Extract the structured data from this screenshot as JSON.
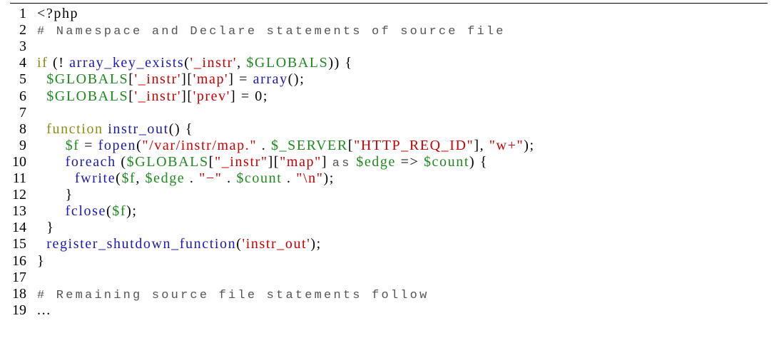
{
  "colors": {
    "keyword": "#8c8c14",
    "function": "#1b1bb3",
    "string": "#cc0000",
    "variable": "#1f8a1f",
    "comment": "#555555",
    "plain": "#000000"
  },
  "lines": [
    {
      "n": "1",
      "tokens": [
        {
          "t": "<?php",
          "c": "plain"
        }
      ]
    },
    {
      "n": "2",
      "tokens": [
        {
          "t": "# Namespace and Declare statements of source file",
          "c": "comment"
        }
      ]
    },
    {
      "n": "3",
      "tokens": []
    },
    {
      "n": "4",
      "tokens": [
        {
          "t": "if",
          "c": "keyword"
        },
        {
          "t": " (! ",
          "c": "plain"
        },
        {
          "t": "array_key_exists",
          "c": "function"
        },
        {
          "t": "(",
          "c": "plain"
        },
        {
          "t": "'_instr'",
          "c": "string"
        },
        {
          "t": ", ",
          "c": "plain"
        },
        {
          "t": "$GLOBALS",
          "c": "variable"
        },
        {
          "t": ")) {",
          "c": "plain"
        }
      ]
    },
    {
      "n": "5",
      "tokens": [
        {
          "t": "  ",
          "c": "plain"
        },
        {
          "t": "$GLOBALS",
          "c": "variable"
        },
        {
          "t": "[",
          "c": "plain"
        },
        {
          "t": "'_instr'",
          "c": "string"
        },
        {
          "t": "][",
          "c": "plain"
        },
        {
          "t": "'map'",
          "c": "string"
        },
        {
          "t": "] = ",
          "c": "plain"
        },
        {
          "t": "array",
          "c": "function"
        },
        {
          "t": "();",
          "c": "plain"
        }
      ]
    },
    {
      "n": "6",
      "tokens": [
        {
          "t": "  ",
          "c": "plain"
        },
        {
          "t": "$GLOBALS",
          "c": "variable"
        },
        {
          "t": "[",
          "c": "plain"
        },
        {
          "t": "'_instr'",
          "c": "string"
        },
        {
          "t": "][",
          "c": "plain"
        },
        {
          "t": "'prev'",
          "c": "string"
        },
        {
          "t": "] = 0;",
          "c": "plain"
        }
      ]
    },
    {
      "n": "7",
      "tokens": []
    },
    {
      "n": "8",
      "tokens": [
        {
          "t": "  ",
          "c": "plain"
        },
        {
          "t": "function",
          "c": "keyword"
        },
        {
          "t": " ",
          "c": "plain"
        },
        {
          "t": "instr_out",
          "c": "function"
        },
        {
          "t": "() {",
          "c": "plain"
        }
      ]
    },
    {
      "n": "9",
      "tokens": [
        {
          "t": "      ",
          "c": "plain"
        },
        {
          "t": "$f",
          "c": "variable"
        },
        {
          "t": " = ",
          "c": "plain"
        },
        {
          "t": "fopen",
          "c": "function"
        },
        {
          "t": "(",
          "c": "plain"
        },
        {
          "t": "\"/var/instr/map.\"",
          "c": "string"
        },
        {
          "t": " . ",
          "c": "plain"
        },
        {
          "t": "$_SERVER",
          "c": "variable"
        },
        {
          "t": "[",
          "c": "plain"
        },
        {
          "t": "\"HTTP_REQ_ID\"",
          "c": "string"
        },
        {
          "t": "], ",
          "c": "plain"
        },
        {
          "t": "\"w+\"",
          "c": "string"
        },
        {
          "t": ");",
          "c": "plain"
        }
      ]
    },
    {
      "n": "10",
      "tokens": [
        {
          "t": "      ",
          "c": "plain"
        },
        {
          "t": "foreach",
          "c": "function"
        },
        {
          "t": " (",
          "c": "plain"
        },
        {
          "t": "$GLOBALS",
          "c": "variable"
        },
        {
          "t": "[",
          "c": "plain"
        },
        {
          "t": "\"_instr\"",
          "c": "string"
        },
        {
          "t": "][",
          "c": "plain"
        },
        {
          "t": "\"map\"",
          "c": "string"
        },
        {
          "t": "] ",
          "c": "plain"
        },
        {
          "t": "as",
          "c": "comment"
        },
        {
          "t": " ",
          "c": "plain"
        },
        {
          "t": "$edge",
          "c": "variable"
        },
        {
          "t": " => ",
          "c": "plain"
        },
        {
          "t": "$count",
          "c": "variable"
        },
        {
          "t": ") {",
          "c": "plain"
        }
      ]
    },
    {
      "n": "11",
      "tokens": [
        {
          "t": "        ",
          "c": "plain"
        },
        {
          "t": "fwrite",
          "c": "function"
        },
        {
          "t": "(",
          "c": "plain"
        },
        {
          "t": "$f",
          "c": "variable"
        },
        {
          "t": ", ",
          "c": "plain"
        },
        {
          "t": "$edge",
          "c": "variable"
        },
        {
          "t": " . ",
          "c": "plain"
        },
        {
          "t": "\"−\"",
          "c": "string"
        },
        {
          "t": " . ",
          "c": "plain"
        },
        {
          "t": "$count",
          "c": "variable"
        },
        {
          "t": " . ",
          "c": "plain"
        },
        {
          "t": "\"\\n\"",
          "c": "string"
        },
        {
          "t": ");",
          "c": "plain"
        }
      ]
    },
    {
      "n": "12",
      "tokens": [
        {
          "t": "      }",
          "c": "plain"
        }
      ]
    },
    {
      "n": "13",
      "tokens": [
        {
          "t": "      ",
          "c": "plain"
        },
        {
          "t": "fclose",
          "c": "function"
        },
        {
          "t": "(",
          "c": "plain"
        },
        {
          "t": "$f",
          "c": "variable"
        },
        {
          "t": ");",
          "c": "plain"
        }
      ]
    },
    {
      "n": "14",
      "tokens": [
        {
          "t": "  }",
          "c": "plain"
        }
      ]
    },
    {
      "n": "15",
      "tokens": [
        {
          "t": "  ",
          "c": "plain"
        },
        {
          "t": "register_shutdown_function",
          "c": "function"
        },
        {
          "t": "(",
          "c": "plain"
        },
        {
          "t": "'instr_out'",
          "c": "string"
        },
        {
          "t": ");",
          "c": "plain"
        }
      ]
    },
    {
      "n": "16",
      "tokens": [
        {
          "t": "}",
          "c": "plain"
        }
      ]
    },
    {
      "n": "17",
      "tokens": []
    },
    {
      "n": "18",
      "tokens": [
        {
          "t": "# Remaining source file statements follow",
          "c": "comment"
        }
      ]
    },
    {
      "n": "19",
      "tokens": [
        {
          "t": "...",
          "c": "plain"
        }
      ]
    }
  ]
}
